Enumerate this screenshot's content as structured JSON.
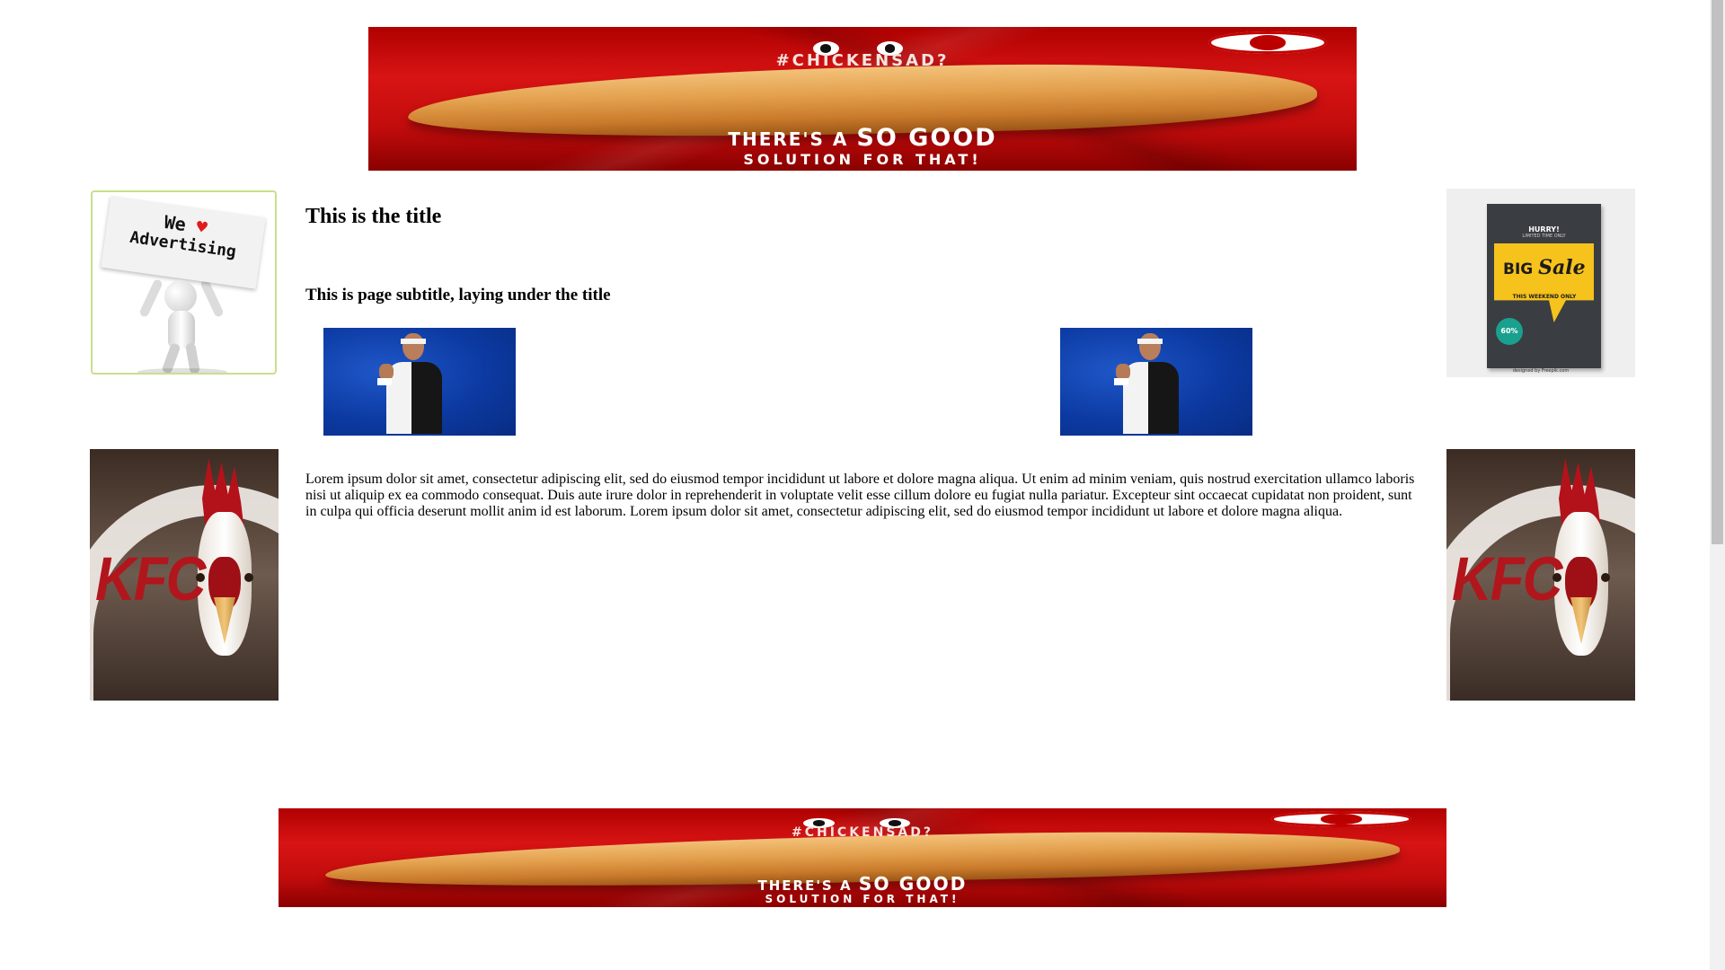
{
  "page": {
    "title": "This is the title",
    "subtitle": "This is page subtitle, laying under the title",
    "body_text": "Lorem ipsum dolor sit amet, consectetur adipiscing elit, sed do eiusmod tempor incididunt ut labore et dolore magna aliqua. Ut enim ad minim veniam, quis nostrud exercitation ullamco laboris nisi ut aliquip ex ea commodo consequat. Duis aute irure dolor in reprehenderit in voluptate velit esse cillum dolore eu fugiat nulla pariatur. Excepteur sint occaecat cupidatat non proident, sunt in culpa qui officia deserunt mollit anim id est laborum. Lorem ipsum dolor sit amet, consectetur adipiscing elit, sed do eiusmod tempor incididunt ut labore et dolore magna aliqua."
  },
  "ads": {
    "kfc_banner": {
      "hashtag": "#CHICKENSAD?",
      "line1_prefix": "THERE'S A ",
      "line1_emphasis": "SO GOOD",
      "line2": "SOLUTION FOR THAT!"
    },
    "we_love": {
      "line1_before": "We ",
      "heart": "♥",
      "line2": "Advertising"
    },
    "big_sale": {
      "hurry": "HURRY!",
      "limited": "LIMITED TIME ONLY",
      "big": "BIG ",
      "sale": "Sale",
      "weekend": "THIS WEEKEND ONLY",
      "percent": "60%",
      "credit": "designed by Freepik.com"
    },
    "kfc_square": {
      "brand": "KFC"
    }
  },
  "colors": {
    "kfc_red": "#c40000",
    "sale_yellow": "#f6c21c",
    "tennis_blue": "#0c3aa2"
  }
}
